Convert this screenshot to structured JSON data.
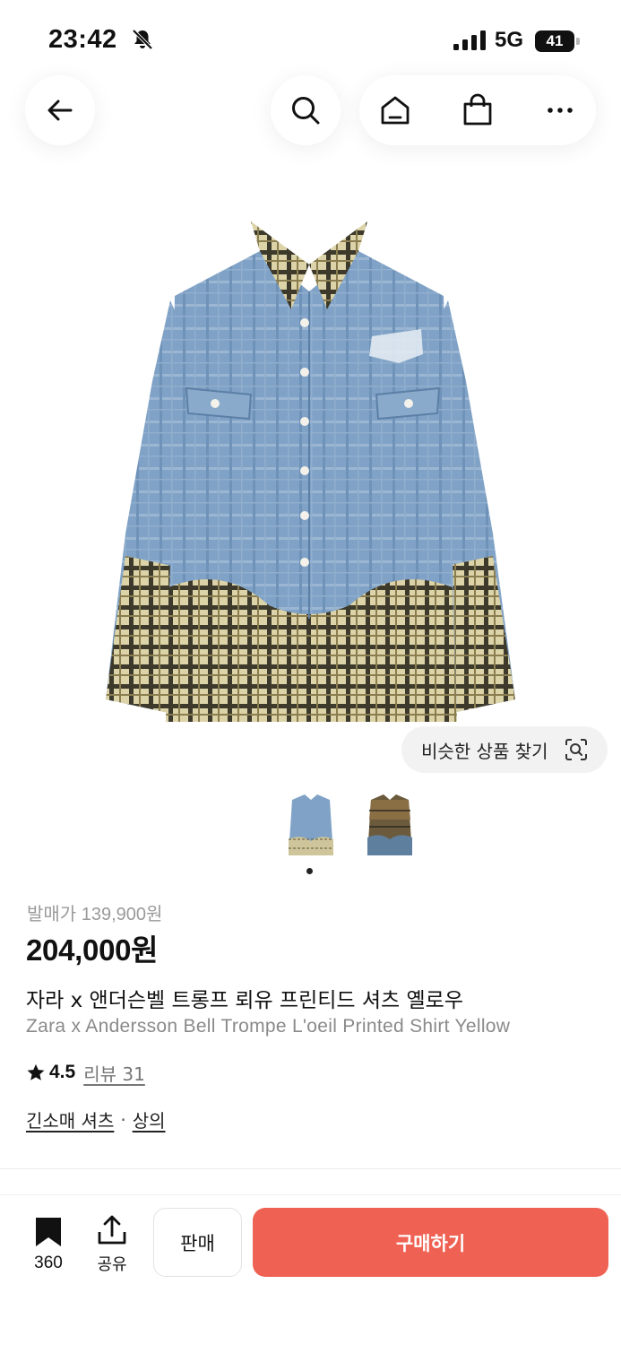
{
  "status_bar": {
    "time": "23:42",
    "network": "5G",
    "battery": "41"
  },
  "nav": {
    "back_icon": "arrow-left-icon",
    "search_icon": "search-icon",
    "home_icon": "home-icon",
    "cart_icon": "shopping-bag-icon",
    "more_icon": "more-horizontal-icon"
  },
  "gallery": {
    "similar_button_label": "비슷한 상품 찾기",
    "thumbnail_count": 2,
    "active_index": 0
  },
  "product": {
    "release_price": "발매가 139,900원",
    "price": "204,000원",
    "name_ko": "자라 x 앤더슨벨 트롱프 뢰유 프린티드 셔츠 옐로우",
    "name_en": "Zara x Andersson Bell Trompe L'oeil Printed Shirt Yellow",
    "rating": "4.5",
    "reviews_label": "리뷰 31",
    "categories": [
      "긴소매 셔츠",
      "상의"
    ],
    "category_separator": "·"
  },
  "bottom_bar": {
    "bookmark_count": "360",
    "share_label": "공유",
    "sell_label": "판매",
    "buy_label": "구매하기"
  },
  "colors": {
    "buy_button": "#ef6253",
    "denim": "#7ea0c4",
    "plaid": "#d9cfa3"
  }
}
